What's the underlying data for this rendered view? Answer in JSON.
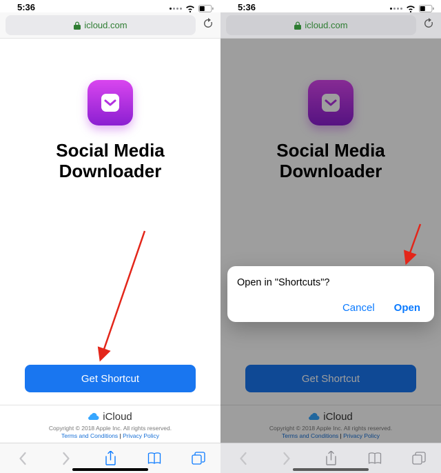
{
  "statusbar": {
    "time": "5:36"
  },
  "safari": {
    "domain": "icloud.com"
  },
  "page": {
    "title_l1": "Social Media",
    "title_l2": "Downloader",
    "get_button": "Get Shortcut",
    "icloud_label": "iCloud",
    "copyright": "Copyright © 2018 Apple Inc. All rights reserved.",
    "terms": "Terms and Conditions",
    "privacy": "Privacy Policy",
    "sep": " | "
  },
  "alert": {
    "title": "Open in \"Shortcuts\"?",
    "cancel": "Cancel",
    "open": "Open"
  }
}
